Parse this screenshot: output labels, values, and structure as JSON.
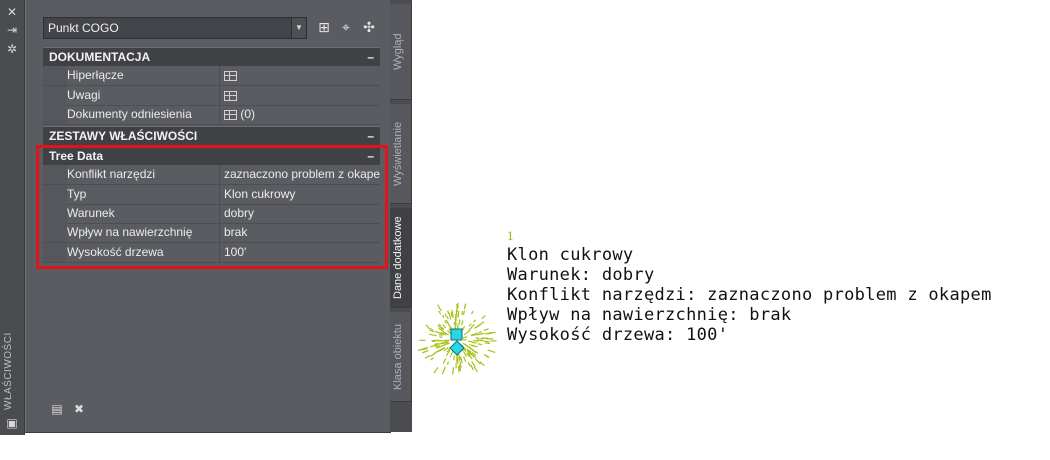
{
  "palette": {
    "vertical_title": "WŁAŚCIWOŚCI",
    "icons": [
      "close-icon",
      "auto-hide-icon",
      "settings-icon",
      "properties-icon"
    ]
  },
  "selector": {
    "value": "Punkt COGO"
  },
  "toolbar_icons": [
    "add-to-selection-icon",
    "pick-objects-icon",
    "quick-select-icon"
  ],
  "sections": {
    "dokumentacja": {
      "title": "DOKUMENTACJA",
      "rows": [
        {
          "key": "Hiperłącze",
          "value": ""
        },
        {
          "key": "Uwagi",
          "value": ""
        },
        {
          "key": "Dokumenty odniesienia",
          "value": "(0)"
        }
      ]
    },
    "zestawy": {
      "title": "ZESTAWY WŁAŚCIWOŚCI"
    },
    "tree_data": {
      "title": "Tree Data",
      "rows": [
        {
          "key": "Konflikt narzędzi",
          "value": "zaznaczono problem z okapem"
        },
        {
          "key": "Typ",
          "value": "Klon cukrowy"
        },
        {
          "key": "Warunek",
          "value": "dobry"
        },
        {
          "key": "Wpływ na nawierzchnię",
          "value": "brak"
        },
        {
          "key": "Wysokość drzewa",
          "value": "100'"
        }
      ]
    }
  },
  "tabs": [
    {
      "label": "Wygląd",
      "active": false
    },
    {
      "label": "Wyświetlanie",
      "active": false
    },
    {
      "label": "Dane dodatkowe",
      "active": true
    },
    {
      "label": "Klasa obiektu",
      "active": false
    }
  ],
  "drawing": {
    "point_number": "1",
    "lines": [
      "Klon cukrowy",
      "Warunek: dobry",
      "Konflikt narzędzi: zaznaczono problem z okapem",
      "Wpływ na nawierzchnię: brak",
      "Wysokość drzewa: 100'"
    ]
  },
  "colors": {
    "highlight_box": "#e0141b",
    "tree_symbol": "#a8c21a",
    "grip": "#28d7e0"
  }
}
